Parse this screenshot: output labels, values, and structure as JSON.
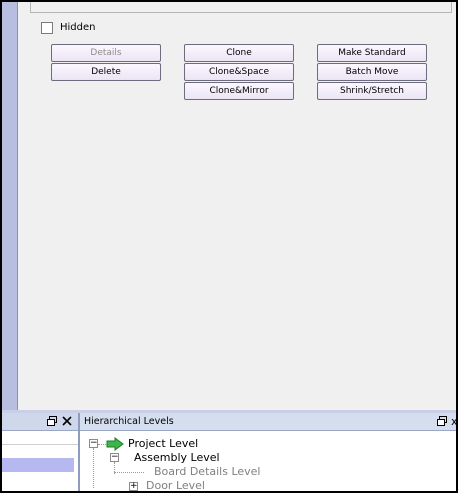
{
  "options": {
    "hidden_label": "Hidden",
    "hidden_checked": false
  },
  "buttons": {
    "details": "Details",
    "delete": "Delete",
    "clone": "Clone",
    "clone_space": "Clone&Space",
    "clone_mirror": "Clone&Mirror",
    "make_standard": "Make Standard",
    "batch_move": "Batch Move",
    "shrink_stretch": "Shrink/Stretch"
  },
  "hierarchy_panel": {
    "title": "Hierarchical Levels",
    "items": [
      {
        "label": "Project Level",
        "expander": "−",
        "color": "#000000"
      },
      {
        "label": "Assembly Level",
        "expander": "−",
        "color": "#000000"
      },
      {
        "label": "Board Details Level",
        "expander": "",
        "color": "#808080"
      },
      {
        "label": "Door Level",
        "expander": "+",
        "color": "#808080"
      }
    ]
  },
  "icons": {
    "restore": "restore-window-icon",
    "close": "close-icon",
    "project": "green-arrow-icon"
  },
  "colors": {
    "panel_bg": "#f0f0f0",
    "frame_blue": "#b8bedf",
    "selected_row": "#b6b9ef",
    "button_border": "#6c6c7e"
  }
}
